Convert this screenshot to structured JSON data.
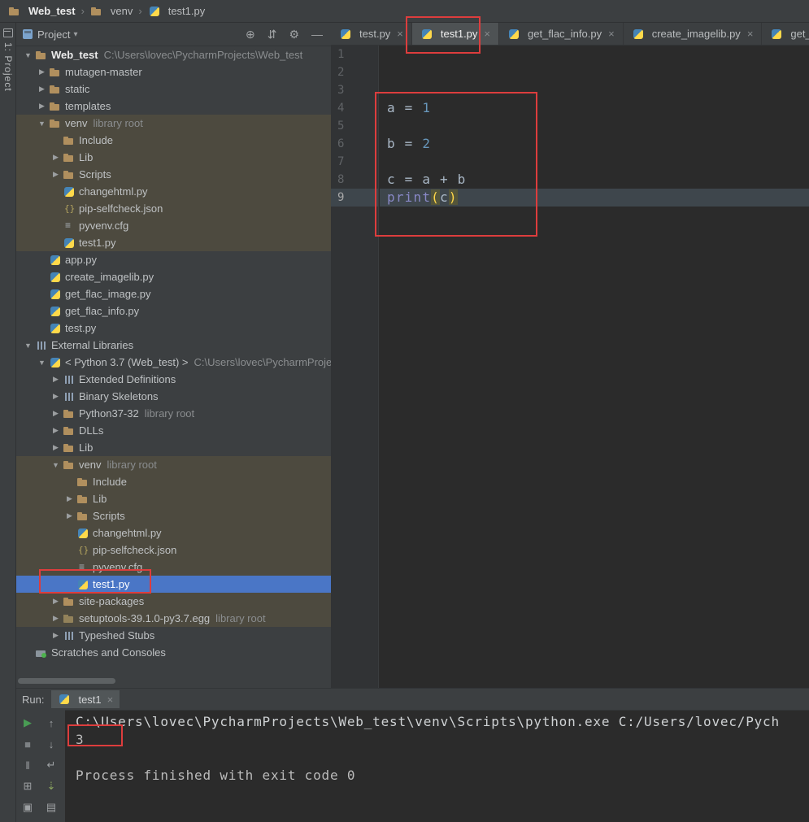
{
  "colors": {
    "selection_blue": "#4a76c6",
    "olive_highlight": "#4d4a3f",
    "annotation_red": "#dd3d3d",
    "run_green": "#499c54",
    "editor_bg": "#2b2b2b",
    "panel_bg": "#3c3f41"
  },
  "breadcrumb": {
    "items": [
      {
        "label": "Web_test",
        "icon": "folder",
        "bold": true
      },
      {
        "label": "venv",
        "icon": "folder"
      },
      {
        "label": "test1.py",
        "icon": "python"
      }
    ]
  },
  "left_strip": {
    "tool_button": "1: Project"
  },
  "project_panel": {
    "title": "Project",
    "dropdown_caret": "▾",
    "header_icons": [
      {
        "name": "locate-file-icon",
        "glyph": "⊕"
      },
      {
        "name": "collapse-all-icon",
        "glyph": "⇵"
      },
      {
        "name": "settings-icon",
        "glyph": "⚙"
      },
      {
        "name": "hide-panel-icon",
        "glyph": "—"
      }
    ],
    "tree": [
      {
        "label": "Web_test",
        "sub": "C:\\Users\\lovec\\PycharmProjects\\Web_test",
        "icon": "folder",
        "arrow": "open",
        "indent": 0,
        "bold": true
      },
      {
        "label": "mutagen-master",
        "icon": "folder",
        "arrow": "closed",
        "indent": 1
      },
      {
        "label": "static",
        "icon": "folder",
        "arrow": "closed",
        "indent": 1
      },
      {
        "label": "templates",
        "icon": "folder",
        "arrow": "closed",
        "indent": 1
      },
      {
        "label": "venv",
        "sub": "library root",
        "icon": "folder",
        "arrow": "open",
        "indent": 1,
        "hl": "olive"
      },
      {
        "label": "Include",
        "icon": "folder",
        "arrow": "none",
        "indent": 2,
        "hl": "olive"
      },
      {
        "label": "Lib",
        "icon": "folder",
        "arrow": "closed",
        "indent": 2,
        "hl": "olive"
      },
      {
        "label": "Scripts",
        "icon": "folder",
        "arrow": "closed",
        "indent": 2,
        "hl": "olive"
      },
      {
        "label": "changehtml.py",
        "icon": "python",
        "arrow": "none",
        "indent": 2,
        "hl": "olive"
      },
      {
        "label": "pip-selfcheck.json",
        "icon": "json",
        "arrow": "none",
        "indent": 2,
        "hl": "olive"
      },
      {
        "label": "pyvenv.cfg",
        "icon": "cfg",
        "arrow": "none",
        "indent": 2,
        "hl": "olive"
      },
      {
        "label": "test1.py",
        "icon": "python",
        "arrow": "none",
        "indent": 2,
        "hl": "olive"
      },
      {
        "label": "app.py",
        "icon": "python",
        "arrow": "none",
        "indent": 1
      },
      {
        "label": "create_imagelib.py",
        "icon": "python",
        "arrow": "none",
        "indent": 1
      },
      {
        "label": "get_flac_image.py",
        "icon": "python",
        "arrow": "none",
        "indent": 1
      },
      {
        "label": "get_flac_info.py",
        "icon": "python",
        "arrow": "none",
        "indent": 1
      },
      {
        "label": "test.py",
        "icon": "python",
        "arrow": "none",
        "indent": 1
      },
      {
        "label": "External Libraries",
        "icon": "libs",
        "arrow": "open",
        "indent": 0
      },
      {
        "label": "< Python 3.7 (Web_test) >",
        "sub": "C:\\Users\\lovec\\PycharmProjec",
        "icon": "interp",
        "arrow": "open",
        "indent": 1
      },
      {
        "label": "Extended Definitions",
        "icon": "libs",
        "arrow": "closed",
        "indent": 2
      },
      {
        "label": "Binary Skeletons",
        "icon": "libs",
        "arrow": "closed",
        "indent": 2
      },
      {
        "label": "Python37-32",
        "sub": "library root",
        "icon": "folder",
        "arrow": "closed",
        "indent": 2
      },
      {
        "label": "DLLs",
        "icon": "folder",
        "arrow": "closed",
        "indent": 2
      },
      {
        "label": "Lib",
        "icon": "folder",
        "arrow": "closed",
        "indent": 2
      },
      {
        "label": "venv",
        "sub": "library root",
        "icon": "folder",
        "arrow": "open",
        "indent": 2,
        "hl": "olive"
      },
      {
        "label": "Include",
        "icon": "folder",
        "arrow": "none",
        "indent": 3,
        "hl": "olive"
      },
      {
        "label": "Lib",
        "icon": "folder",
        "arrow": "closed",
        "indent": 3,
        "hl": "olive"
      },
      {
        "label": "Scripts",
        "icon": "folder",
        "arrow": "closed",
        "indent": 3,
        "hl": "olive"
      },
      {
        "label": "changehtml.py",
        "icon": "python",
        "arrow": "none",
        "indent": 3,
        "hl": "olive"
      },
      {
        "label": "pip-selfcheck.json",
        "icon": "json",
        "arrow": "none",
        "indent": 3,
        "hl": "olive"
      },
      {
        "label": "pyvenv.cfg",
        "icon": "cfg",
        "arrow": "none",
        "indent": 3,
        "hl": "olive"
      },
      {
        "label": "test1.py",
        "icon": "python",
        "arrow": "none",
        "indent": 3,
        "hl": "selected"
      },
      {
        "label": "site-packages",
        "icon": "folder",
        "arrow": "closed",
        "indent": 2,
        "hl": "olive"
      },
      {
        "label": "setuptools-39.1.0-py3.7.egg",
        "sub": "library root",
        "icon": "egg",
        "arrow": "closed",
        "indent": 2,
        "hl": "olive"
      },
      {
        "label": "Typeshed Stubs",
        "icon": "libs",
        "arrow": "closed",
        "indent": 2
      },
      {
        "label": "Scratches and Consoles",
        "icon": "scratch",
        "arrow": "none",
        "indent": 0
      }
    ]
  },
  "editor": {
    "tabs": [
      {
        "label": "test.py"
      },
      {
        "label": "test1.py",
        "active": true
      },
      {
        "label": "get_flac_info.py"
      },
      {
        "label": "create_imagelib.py"
      },
      {
        "label": "get_flac_image.py"
      }
    ],
    "gutter_lines": 9,
    "current_line": 9,
    "code_lines": [
      {
        "line": 4,
        "segments": [
          {
            "text": "a = ",
            "cls": "plain"
          },
          {
            "text": "1",
            "cls": "num"
          }
        ]
      },
      {
        "line": 6,
        "segments": [
          {
            "text": "b = ",
            "cls": "plain"
          },
          {
            "text": "2",
            "cls": "num"
          }
        ]
      },
      {
        "line": 8,
        "segments": [
          {
            "text": "c = a + b",
            "cls": "plain"
          }
        ]
      },
      {
        "line": 9,
        "segments": [
          {
            "text": "print",
            "cls": "builtin"
          },
          {
            "text": "(",
            "cls": "brace"
          },
          {
            "text": "c",
            "cls": "plain"
          },
          {
            "text": ")",
            "cls": "brace"
          }
        ]
      }
    ]
  },
  "run_panel": {
    "label": "Run:",
    "tab": {
      "label": "test1",
      "icon": "python"
    },
    "toolbar": [
      {
        "name": "rerun-button",
        "glyph": "▶",
        "color": "#499c54"
      },
      {
        "name": "move-up-icon",
        "glyph": "↑",
        "color": "#9da0a3"
      },
      {
        "name": "stop-button",
        "glyph": "■",
        "color": "#7d8184"
      },
      {
        "name": "move-down-icon",
        "glyph": "↓",
        "color": "#9da0a3"
      },
      {
        "name": "pause-button",
        "glyph": "‖",
        "color": "#9da0a3"
      },
      {
        "name": "soft-wrap-icon",
        "glyph": "↵",
        "color": "#9da0a3"
      },
      {
        "name": "restore-layout-icon",
        "glyph": "⊞",
        "color": "#9da0a3"
      },
      {
        "name": "scroll-to-end-icon",
        "glyph": "⇣",
        "color": "#8aa55f"
      },
      {
        "name": "pin-icon",
        "glyph": "▣",
        "color": "#9da0a3"
      },
      {
        "name": "print-icon",
        "glyph": "▤",
        "color": "#9da0a3"
      }
    ],
    "console": [
      {
        "name": "console-command-line",
        "cls": "cmd",
        "text": "C:\\Users\\lovec\\PycharmProjects\\Web_test\\venv\\Scripts\\python.exe C:/Users/lovec/Pych"
      },
      {
        "name": "console-output-value",
        "cls": "out",
        "text": "3"
      },
      {
        "name": "console-blank-line",
        "cls": "out",
        "text": ""
      },
      {
        "name": "console-exit-message",
        "cls": "out",
        "text": "Process finished with exit code 0"
      }
    ]
  }
}
